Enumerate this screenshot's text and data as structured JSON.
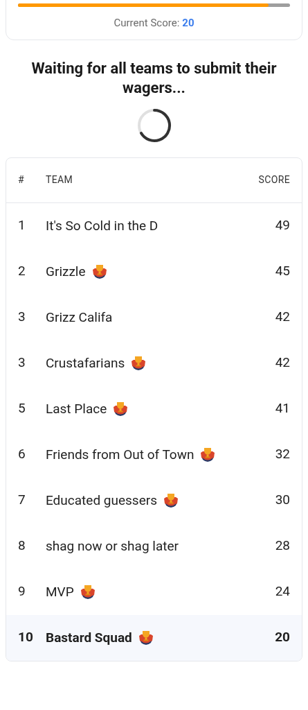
{
  "score_card": {
    "progress": {
      "level": 0.92
    },
    "label": "Current Score:",
    "score": "20"
  },
  "status": {
    "message": "Waiting for all teams to submit their wagers..."
  },
  "table": {
    "columns": [
      "#",
      "TEAM",
      "SCORE"
    ],
    "rows": [
      {
        "rank": "1",
        "team": "It's So Cold in the D",
        "score": "49",
        "badge": false,
        "selected": false
      },
      {
        "rank": "2",
        "team": "Grizzle",
        "score": "45",
        "badge": true,
        "selected": false
      },
      {
        "rank": "3",
        "team": "Grizz Califa",
        "score": "42",
        "badge": false,
        "selected": false
      },
      {
        "rank": "3",
        "team": "Crustafarians",
        "score": "42",
        "badge": true,
        "selected": false
      },
      {
        "rank": "5",
        "team": "Last Place",
        "score": "41",
        "badge": true,
        "selected": false
      },
      {
        "rank": "6",
        "team": "Friends from Out of Town",
        "score": "32",
        "badge": true,
        "selected": false
      },
      {
        "rank": "7",
        "team": "Educated guessers",
        "score": "30",
        "badge": true,
        "selected": false
      },
      {
        "rank": "8",
        "team": "shag now or shag later",
        "score": "28",
        "badge": false,
        "selected": false
      },
      {
        "rank": "9",
        "team": "MVP",
        "score": "24",
        "badge": true,
        "selected": false
      },
      {
        "rank": "10",
        "team": "Bastard Squad",
        "score": "20",
        "badge": true,
        "selected": true
      }
    ]
  }
}
